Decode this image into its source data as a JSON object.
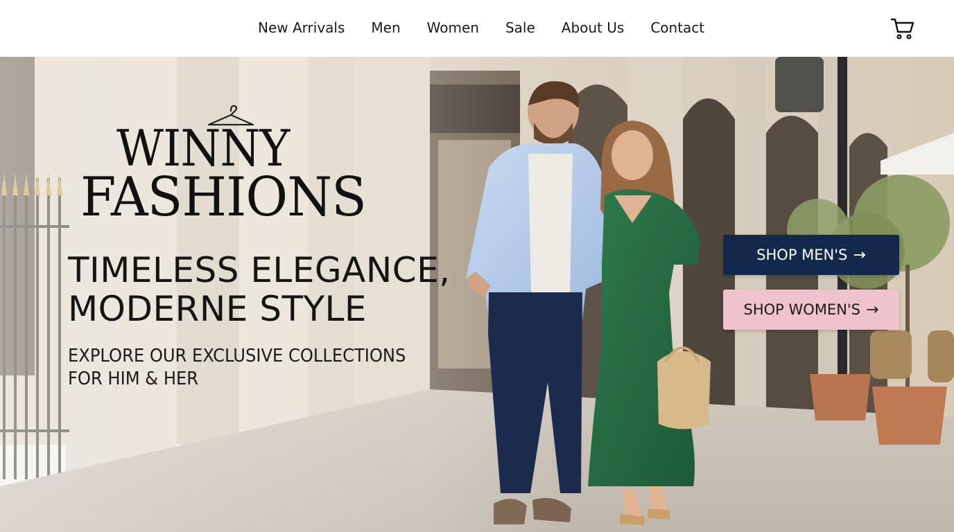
{
  "nav": {
    "items": [
      "New Arrivals",
      "Men",
      "Women",
      "Sale",
      "About Us",
      "Contact"
    ],
    "cart_icon": "shopping-cart-icon"
  },
  "hero": {
    "brand": {
      "line1": "WINNY",
      "line2": "FASHIONS",
      "icon": "hanger-icon"
    },
    "headline": [
      "TIMELESS ELEGANCE,",
      "MODERNE STYLE"
    ],
    "subheadline": [
      "EXPLORE OUR EXCLUSIVE COLLECTIONS",
      "FOR HIM & HER"
    ],
    "buttons": {
      "men": {
        "label": "SHOP MEN'S",
        "arrow": "→",
        "color": "#13294b"
      },
      "women": {
        "label": "SHOP WOMEN'S",
        "arrow": "→",
        "color": "#efc3cb"
      }
    }
  },
  "colors": {
    "accent_navy": "#13294b",
    "accent_pink": "#efc3cb",
    "text": "#141414"
  }
}
